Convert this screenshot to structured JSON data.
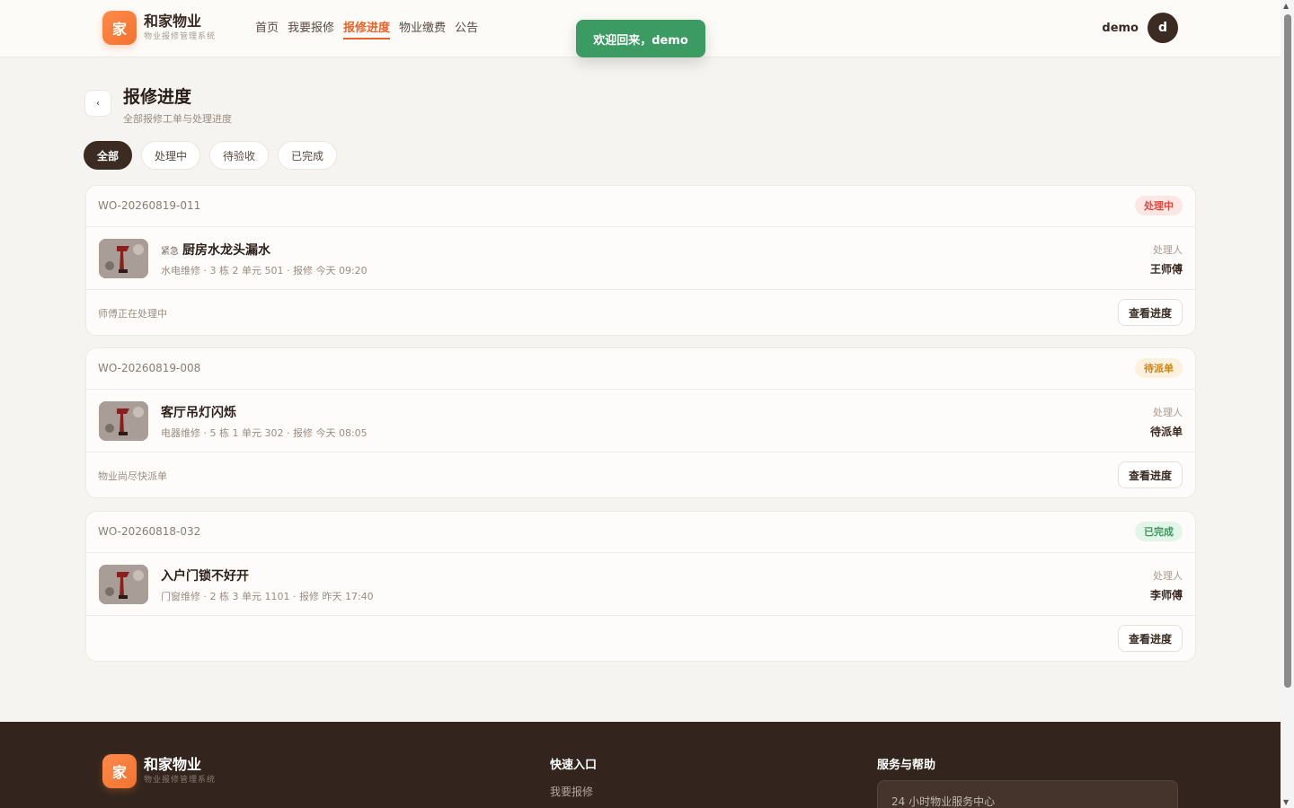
{
  "header": {
    "logo_char": "家",
    "brand_name": "和家物业",
    "brand_sub": "物业报修管理系统",
    "nav": [
      {
        "label": "首页",
        "active": false
      },
      {
        "label": "我要报修",
        "active": false
      },
      {
        "label": "报修进度",
        "active": true
      },
      {
        "label": "物业缴费",
        "active": false
      },
      {
        "label": "公告",
        "active": false
      }
    ],
    "user_name": "demo",
    "avatar_char": "d"
  },
  "toast": {
    "message": "欢迎回来，demo"
  },
  "page": {
    "back_symbol": "‹",
    "title": "报修进度",
    "subtitle": "全部报修工单与处理进度"
  },
  "filters": [
    {
      "label": "全部",
      "active": true
    },
    {
      "label": "处理中",
      "active": false
    },
    {
      "label": "待验收",
      "active": false
    },
    {
      "label": "已完成",
      "active": false
    }
  ],
  "orders": [
    {
      "order_no": "WO-20260819-011",
      "status": "处理中",
      "status_color": "#e2473f",
      "status_bg": "#fde7e4",
      "urgent": "紧急",
      "title": "厨房水龙头漏水",
      "meta": "水电维修 · 3 栋 2 单元 501 · 报修 今天 09:20",
      "handler_label": "处理人",
      "handler": "王师傅",
      "note": "师傅正在处理中",
      "action": "查看进度"
    },
    {
      "order_no": "WO-20260819-008",
      "status": "待派单",
      "status_color": "#c98419",
      "status_bg": "#fcf1dc",
      "urgent": "",
      "title": "客厅吊灯闪烁",
      "meta": "电器维修 · 5 栋 1 单元 302 · 报修 今天 08:05",
      "handler_label": "处理人",
      "handler": "待派单",
      "note": "物业尚尽快派单",
      "action": "查看进度"
    },
    {
      "order_no": "WO-20260818-032",
      "status": "已完成",
      "status_color": "#3a9a5d",
      "status_bg": "#e3f4e8",
      "urgent": "",
      "title": "入户门锁不好开",
      "meta": "门窗维修 · 2 栋 3 单元 1101 · 报修 昨天 17:40",
      "handler_label": "处理人",
      "handler": "李师傅",
      "note": "",
      "action": "查看进度"
    }
  ],
  "footer": {
    "logo_char": "家",
    "brand_name": "和家物业",
    "brand_sub": "物业报修管理系统",
    "quick_title": "快速入口",
    "quick_link": "我要报修",
    "help_title": "服务与帮助",
    "help_box": "24 小时物业服务中心"
  },
  "colors": {
    "accent": "#e8632b",
    "dark": "#3b2b22",
    "toast": "#3c9a63"
  }
}
